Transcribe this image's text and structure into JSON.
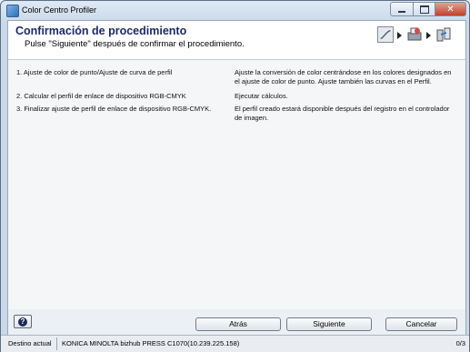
{
  "window": {
    "title": "Color Centro Profiler",
    "minimize_icon": "minimize-icon",
    "maximize_icon": "maximize-icon",
    "close_icon": "close-icon",
    "close_glyph": "✕"
  },
  "header": {
    "title": "Confirmación de procedimiento",
    "subtitle": "Pulse \"Siguiente\" después de confirmar el procedimiento.",
    "step_icons": [
      "color-curve-icon",
      "printer-icon",
      "profile-link-icon"
    ]
  },
  "procedure": [
    {
      "step": "1. Ajuste de color de punto/Ajuste de curva de perfil",
      "description": "Ajuste la conversión de color centrándose en los colores designados en el ajuste de color de punto. Ajuste también las curvas en el Perfil."
    },
    {
      "step": "2. Calcular el perfil de enlace de dispositivo RGB-CMYK",
      "description": "Ejecutar cálculos."
    },
    {
      "step": "3. Finalizar ajuste de perfil de enlace de dispositivo RGB-CMYK.",
      "description": "El perfil creado estará disponible después del registro en el controlador de imagen."
    }
  ],
  "footer": {
    "help_glyph": "?",
    "back_label": "Atrás",
    "next_label": "Siguiente",
    "cancel_label": "Cancelar"
  },
  "statusbar": {
    "label": "Destino actual",
    "device": "KONICA MINOLTA bizhub PRESS C1070(10.239.225.158)",
    "count": "0/3"
  },
  "colors": {
    "title_color": "#1b2a6b",
    "close_button": "#c1412b",
    "frame": "#c9d9ea"
  }
}
